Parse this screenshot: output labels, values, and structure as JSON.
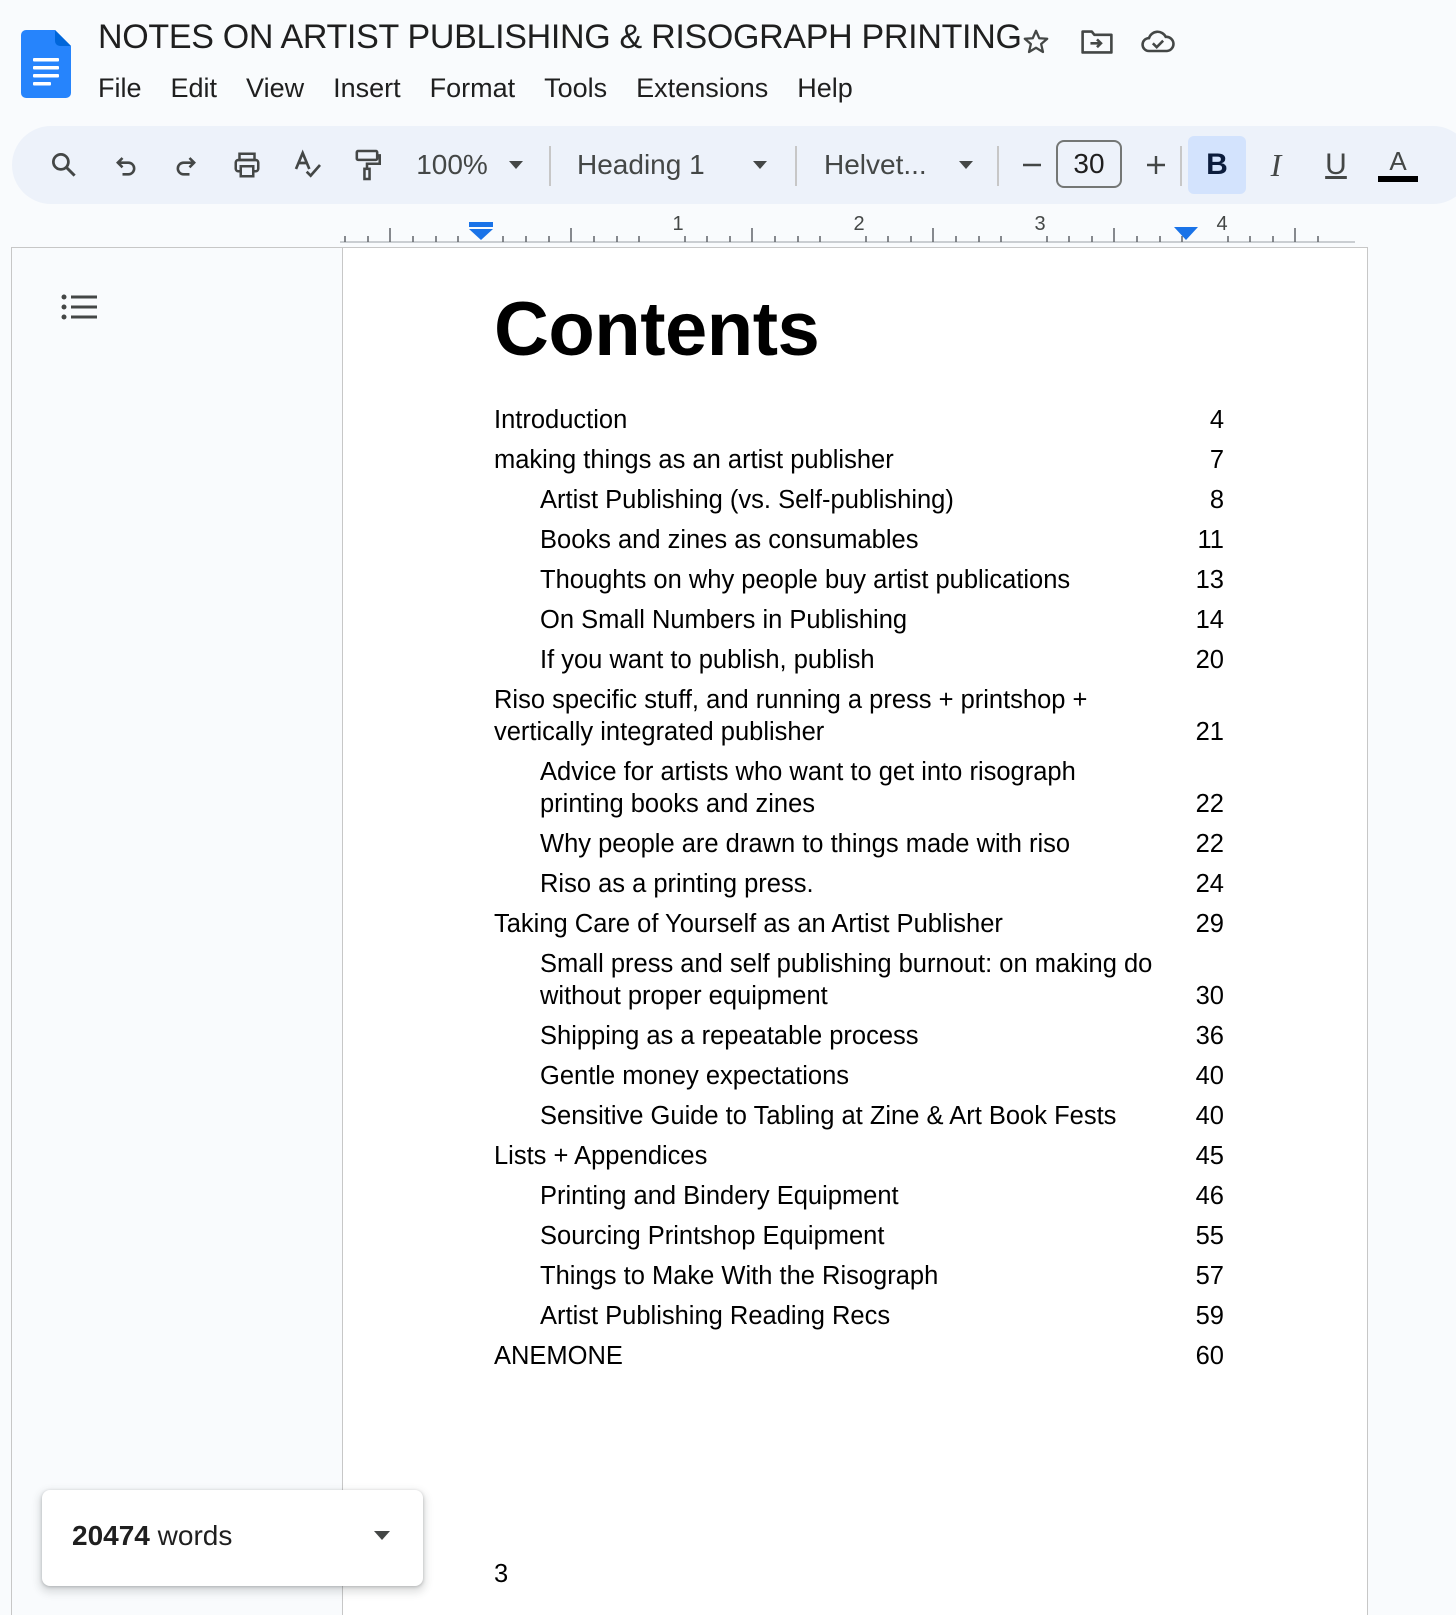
{
  "app": {
    "title": "NOTES ON ARTIST PUBLISHING & RISOGRAPH PRINTING",
    "icons": [
      "docs-logo-icon",
      "star-icon",
      "move-folder-icon",
      "cloud-saved-icon"
    ]
  },
  "menu": {
    "items": [
      "File",
      "Edit",
      "View",
      "Insert",
      "Format",
      "Tools",
      "Extensions",
      "Help"
    ]
  },
  "toolbar": {
    "zoom": "100%",
    "style": "Heading 1",
    "font": "Helvet...",
    "font_size": "30",
    "bold_label": "B",
    "italic_label": "I",
    "underline_label": "U",
    "text_color_label": "A",
    "icons": [
      "search-icon",
      "undo-icon",
      "redo-icon",
      "print-icon",
      "spellcheck-icon",
      "paint-format-icon",
      "minus-icon",
      "plus-icon"
    ]
  },
  "ruler": {
    "labels": [
      "1",
      "2",
      "3",
      "4"
    ]
  },
  "document": {
    "heading": "Contents",
    "toc": [
      {
        "text": "Introduction",
        "page": "4",
        "level": 1
      },
      {
        "text": "making things as an artist publisher",
        "page": "7",
        "level": 1
      },
      {
        "text": "Artist Publishing (vs. Self-publishing)",
        "page": "8",
        "level": 2
      },
      {
        "text": "Books and zines as consumables",
        "page": "11",
        "level": 2
      },
      {
        "text": "Thoughts on why people buy artist publications",
        "page": "13",
        "level": 2
      },
      {
        "text": "On Small Numbers in Publishing",
        "page": "14",
        "level": 2
      },
      {
        "text": "If you want to publish, publish",
        "page": "20",
        "level": 2
      },
      {
        "text": "Riso specific stuff, and running a press + printshop + vertically integrated publisher",
        "page": "21",
        "level": 1
      },
      {
        "text": "Advice for artists who want to get into risograph printing books and zines",
        "page": "22",
        "level": 2
      },
      {
        "text": "Why people are drawn to things made with riso",
        "page": "22",
        "level": 2
      },
      {
        "text": "Riso as a printing press.",
        "page": "24",
        "level": 2
      },
      {
        "text": "Taking Care of Yourself as an Artist Publisher",
        "page": "29",
        "level": 1
      },
      {
        "text": "Small press and self publishing burnout: on making do without proper equipment",
        "page": "30",
        "level": 2
      },
      {
        "text": "Shipping as a repeatable process",
        "page": "36",
        "level": 2
      },
      {
        "text": "Gentle money expectations",
        "page": "40",
        "level": 2
      },
      {
        "text": "Sensitive Guide to Tabling at Zine & Art Book Fests",
        "page": "40",
        "level": 2
      },
      {
        "text": "Lists + Appendices",
        "page": "45",
        "level": 1
      },
      {
        "text": "Printing and Bindery Equipment",
        "page": "46",
        "level": 2
      },
      {
        "text": "Sourcing Printshop Equipment",
        "page": "55",
        "level": 2
      },
      {
        "text": "Things to Make With the Risograph",
        "page": "57",
        "level": 2
      },
      {
        "text": "Artist Publishing Reading Recs",
        "page": "59",
        "level": 2
      },
      {
        "text": "ANEMONE",
        "page": "60",
        "level": 1
      }
    ],
    "page_number": "3"
  },
  "wordcount": {
    "count": "20474",
    "unit": "words"
  },
  "colors": {
    "accent": "#1a73e8",
    "toolbar_bg": "#edf2fa",
    "bold_active": "#d3e3fd"
  }
}
